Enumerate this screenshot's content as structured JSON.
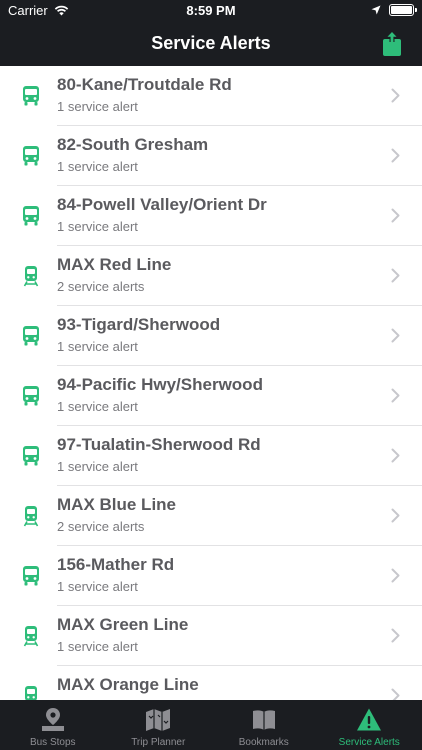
{
  "status_bar": {
    "carrier": "Carrier",
    "time": "8:59 PM"
  },
  "nav": {
    "title": "Service Alerts",
    "share_icon": "share-icon"
  },
  "colors": {
    "accent": "#2ebd7a",
    "bar_bg": "#1b1d21",
    "title_text": "#5a5a5e",
    "subtitle_text": "#7a7a7e",
    "tab_inactive": "#8e8e93"
  },
  "alerts": [
    {
      "icon": "bus-icon",
      "title": "80-Kane/Troutdale Rd",
      "subtitle": "1 service alert"
    },
    {
      "icon": "bus-icon",
      "title": "82-South Gresham",
      "subtitle": "1 service alert"
    },
    {
      "icon": "bus-icon",
      "title": "84-Powell Valley/Orient Dr",
      "subtitle": "1 service alert"
    },
    {
      "icon": "train-icon",
      "title": "MAX Red Line",
      "subtitle": "2 service alerts"
    },
    {
      "icon": "bus-icon",
      "title": "93-Tigard/Sherwood",
      "subtitle": "1 service alert"
    },
    {
      "icon": "bus-icon",
      "title": "94-Pacific Hwy/Sherwood",
      "subtitle": "1 service alert"
    },
    {
      "icon": "bus-icon",
      "title": "97-Tualatin-Sherwood Rd",
      "subtitle": "1 service alert"
    },
    {
      "icon": "train-icon",
      "title": "MAX Blue Line",
      "subtitle": "2 service alerts"
    },
    {
      "icon": "bus-icon",
      "title": "156-Mather Rd",
      "subtitle": "1 service alert"
    },
    {
      "icon": "train-icon",
      "title": "MAX Green Line",
      "subtitle": "1 service alert"
    },
    {
      "icon": "train-icon",
      "title": "MAX Orange Line",
      "subtitle": ""
    }
  ],
  "tabs": [
    {
      "label": "Bus Stops",
      "icon": "map-pin-icon",
      "active": false
    },
    {
      "label": "Trip Planner",
      "icon": "trip-map-icon",
      "active": false
    },
    {
      "label": "Bookmarks",
      "icon": "book-icon",
      "active": false
    },
    {
      "label": "Service Alerts",
      "icon": "warning-icon",
      "active": true
    }
  ]
}
